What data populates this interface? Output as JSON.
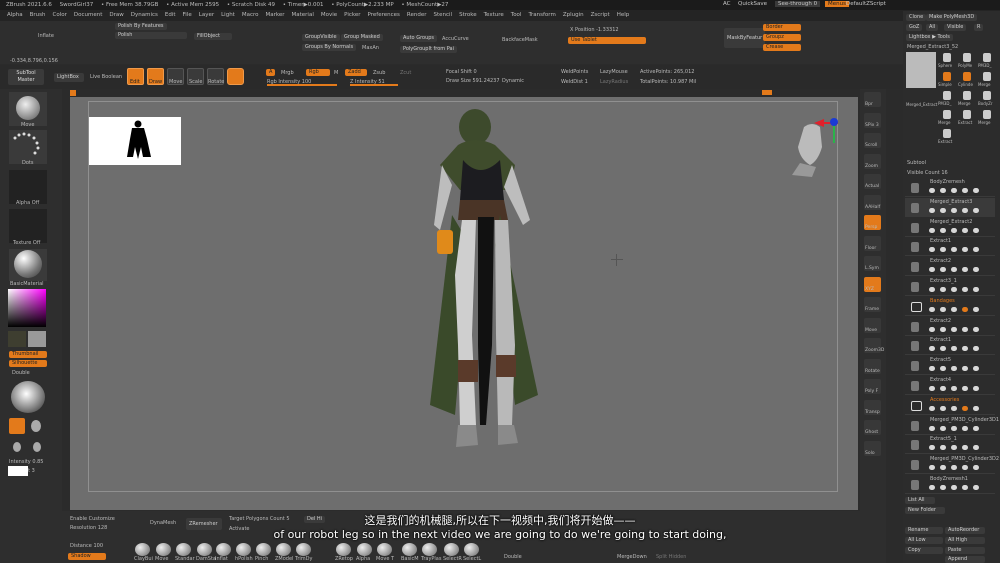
{
  "titlebar": {
    "app": "ZBrush 2021.6.6",
    "doc": "SwordGirl37",
    "free_mem": "• Free Mem 38.79GB",
    "active_mem": "• Active Mem 2595",
    "scratch": "• Scratch Disk 49",
    "timer": "• Timer▶0.001",
    "polycount": "• PolyCount▶2.233 MP",
    "meshcount": "• MeshCount▶27",
    "ac": "AC",
    "quicksave": "QuickSave",
    "seethrough": "See-through  0",
    "menus": "Menus",
    "zscript": "DefaultZScript"
  },
  "menu_items": [
    "Alpha",
    "Brush",
    "Color",
    "Document",
    "Draw",
    "Dynamics",
    "Edit",
    "File",
    "Layer",
    "Light",
    "Macro",
    "Marker",
    "Material",
    "Movie",
    "Picker",
    "Preferences",
    "Render",
    "Stencil",
    "Stroke",
    "Texture",
    "Tool",
    "Transform",
    "Zplugin",
    "Zscript",
    "Help"
  ],
  "row2": {
    "inflate": "Inflate",
    "polish_features": "Polish By Features",
    "polish": "Polish",
    "fill_object": "FillObject",
    "group_visible": "GroupVisible",
    "group_masked": "Group Masked",
    "groups_by_normals": "Groups By Normals",
    "maxangle": "MaxAn",
    "auto_groups": "Auto Groups",
    "acca_curve": "AccuCurve",
    "polygroupit": "PolyGroupIt from Pai",
    "backface_mask": "BackfaceMask",
    "xpos": "X Position -1.33312",
    "use_tablet": "Use Tablet",
    "mask_by_feature": "MaskByFeatur",
    "border": "Border",
    "groups": "Groupz",
    "crease": "Crease"
  },
  "coords": "-0.334,8.796,0.156",
  "shelf": {
    "subtool_master": "SubTool Master",
    "lightbox": "LightBox",
    "live_boolean": "Live Boolean",
    "edit": "Edit",
    "draw": "Draw",
    "move": "Move",
    "scale": "Scale",
    "rotate": "Rotate",
    "a": "A",
    "mrgb": "Mrgb",
    "rgb": "Rgb",
    "m": "M",
    "zadd": "Zadd",
    "zsub": "Zsub",
    "zcut": "Zcut",
    "rgb_intensity": "Rgb Intensity 100",
    "z_intensity": "Z Intensity 51",
    "focal_shift": "Focal Shift 0",
    "draw_size": "Draw Size 591.24237",
    "dynamic": "Dynamic",
    "weld_points": "WeldPoints",
    "lazy_mouse": "LazyMouse",
    "weld_dist": "WeldDist 1",
    "lazy_radius": "LazyRadius",
    "active_points": "ActivePoints: 265,012",
    "total_points": "TotalPoints: 10.987 Mil"
  },
  "left_panel": {
    "move": "Move",
    "dots": "Dots",
    "alpha_off": "Alpha Off",
    "texture_off": "Texture Off",
    "basic_material": "BasicMaterial",
    "thumbnail": "Thumbnail",
    "silhouette": "Silhouette",
    "double": "Double",
    "intensity": "Intensity 0.85",
    "ambient": "Ambient 3"
  },
  "bottom": {
    "enable_customize": "Enable Customize",
    "resolution": "Resolution 128",
    "dynamesh": "DynaMesh",
    "zremesher": "ZRemesher",
    "target_polygons": "Target Polygons Count 5",
    "half": "Half",
    "del_hidden": "Del Hi",
    "activate": "Activate",
    "distance": "Distance 100",
    "shadow": "Shadow",
    "double": "Double",
    "merge_down": "MergeDown",
    "split_hidden": "Split Hidden",
    "brushes": [
      "ClayBui",
      "Move",
      "Standar",
      "DamSta",
      "Inflat",
      "hPolish",
      "Pinch",
      "ZModel",
      "TrimDy",
      "ZRetop",
      "Alpha",
      "Move T",
      "BasicM",
      "TrayPlas",
      "SelectR",
      "SelectL"
    ]
  },
  "subtitles": {
    "zh": "这是我们的机械腿,所以在下一视频中,我们将开始做——",
    "en": "of our robot leg so in the next video we are going to do we're going to start doing,"
  },
  "right_panel": {
    "clone": "Clone",
    "make_polymesh": "Make PolyMesh3D",
    "goz": "GoZ",
    "all": "All",
    "visible": "Visible",
    "r": "R",
    "lightbox_tools": "Lightbox ▶ Tools",
    "current_tool": "Merged_Extract3_52",
    "tool_labels": [
      "Merged_Extract",
      "Sphere",
      "PolyMe",
      "PM3D_",
      "Simple",
      "Cylinde",
      "Merge",
      "PM3D_",
      "Merge",
      "BodyZr",
      "Merge",
      "Extract",
      "Merge",
      "Extract"
    ],
    "subtool": "Subtool",
    "visible_count": "Visible Count 16",
    "list_all": "List All",
    "new_folder": "New Folder",
    "rename": "Rename",
    "autoreorder": "AutoReorder",
    "all_low": "All Low",
    "all_high": "All High",
    "copy": "Copy",
    "paste": "Paste",
    "append": "Append",
    "subtools": [
      {
        "name": "BodyZremesh",
        "hl": false
      },
      {
        "name": "Merged_Extract3",
        "hl": false
      },
      {
        "name": "Merged_Extract2",
        "hl": false
      },
      {
        "name": "Extract1",
        "hl": false
      },
      {
        "name": "Extract2",
        "hl": false
      },
      {
        "name": "Extract3_1",
        "hl": false
      },
      {
        "name": "Bandages",
        "hl": true
      },
      {
        "name": "Extract2",
        "hl": false
      },
      {
        "name": "Extract1",
        "hl": false
      },
      {
        "name": "Extract5",
        "hl": false
      },
      {
        "name": "Extract4",
        "hl": false
      },
      {
        "name": "Accessories",
        "hl": true
      },
      {
        "name": "Merged_PM3D_Cylinder3D1",
        "hl": false
      },
      {
        "name": "Extract5_1",
        "hl": false
      },
      {
        "name": "Merged_PM3D_Cylinder3D2",
        "hl": false
      },
      {
        "name": "BodyZremesh1",
        "hl": false
      }
    ]
  },
  "right_tools": [
    "Bpr",
    "SPix 3",
    "Scroll",
    "Zoom",
    "Actual",
    "AAHalf",
    "Persp",
    "Floor",
    "L.Sym",
    "XYZ",
    "Frame",
    "Move",
    "Zoom3D",
    "Rotate",
    "Poly F",
    "Transp",
    "Ghost",
    "Solo"
  ],
  "colors": {
    "accent": "#e37a1b",
    "bg": "#2b2b2b",
    "canvas": "#777777"
  }
}
